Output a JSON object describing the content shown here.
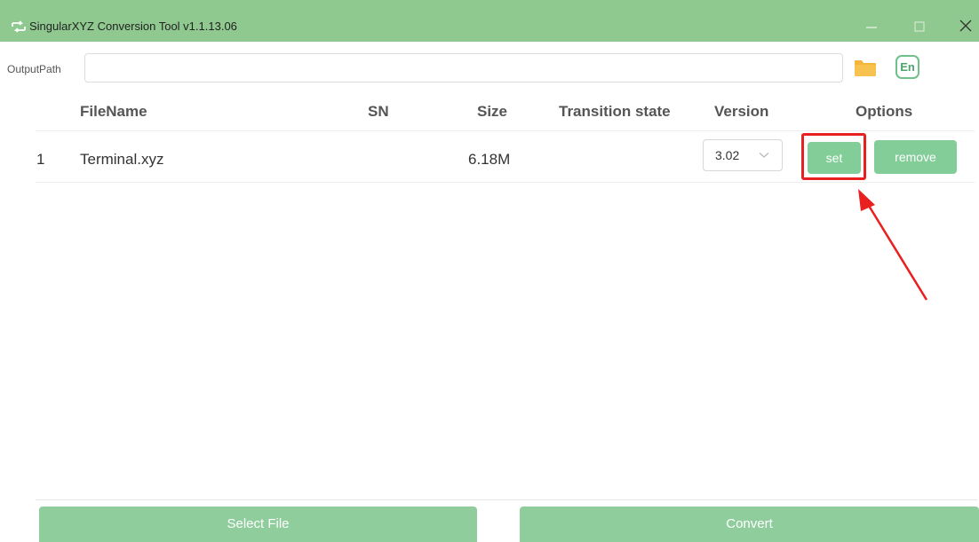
{
  "window": {
    "title": "SingularXYZ Conversion Tool  v1.1.13.06"
  },
  "output": {
    "label": "OutputPath",
    "value": "",
    "lang_label": "En"
  },
  "table": {
    "headers": {
      "filename": "FileName",
      "sn": "SN",
      "size": "Size",
      "transition_state": "Transition state",
      "version": "Version",
      "options": "Options"
    },
    "rows": [
      {
        "index": "1",
        "filename": "Terminal.xyz",
        "sn": "",
        "size": "6.18M",
        "transition_state": "",
        "version": "3.02",
        "set_label": "set",
        "remove_label": "remove"
      }
    ]
  },
  "footer": {
    "select_label": "Select File",
    "convert_label": "Convert"
  },
  "icons": {
    "app": "convert-arrows-icon",
    "folder": "folder-icon",
    "minimize": "minimize-icon",
    "maximize": "maximize-icon",
    "close": "close-icon",
    "chevron": "chevron-down-icon"
  },
  "colors": {
    "titlebar": "#8fc98f",
    "button_green": "#82cd98",
    "footer_green": "#8fce9c",
    "highlight": "#e8201f",
    "folder": "#f5b53d"
  }
}
